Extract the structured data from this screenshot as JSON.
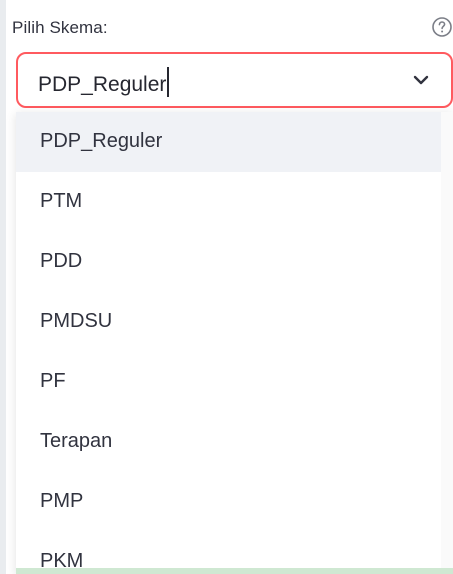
{
  "field": {
    "label": "Pilih Skema:",
    "selected_value": "PDP_Reguler",
    "help_icon": "help-circle-icon",
    "chevron_icon": "chevron-down-icon"
  },
  "dropdown": {
    "options": [
      {
        "label": "PDP_Reguler",
        "selected": true
      },
      {
        "label": "PTM"
      },
      {
        "label": "PDD"
      },
      {
        "label": "PMDSU"
      },
      {
        "label": "PF"
      },
      {
        "label": "Terapan"
      },
      {
        "label": "PMP"
      },
      {
        "label": "PKM"
      }
    ]
  },
  "colors": {
    "focus_border": "#ff5a5f",
    "selected_bg": "#f0f2f6",
    "text": "#31333f"
  }
}
